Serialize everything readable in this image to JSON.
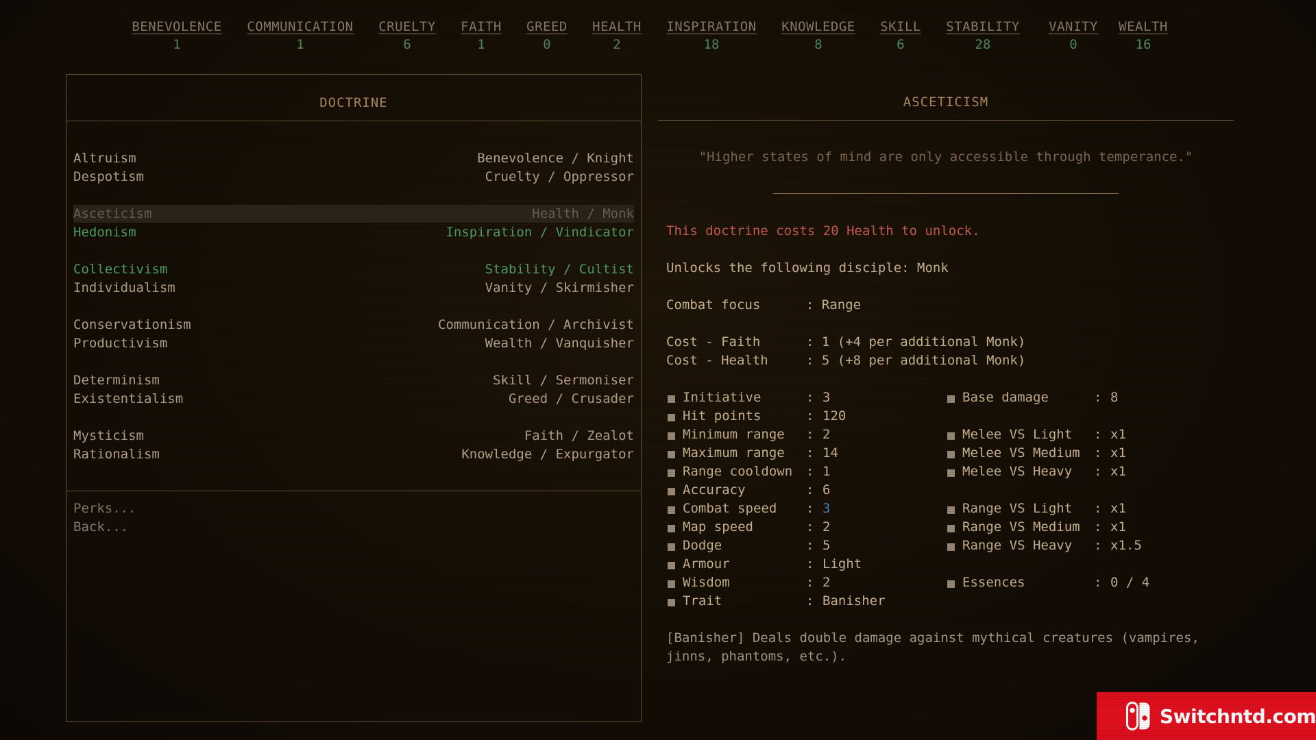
{
  "stats": [
    {
      "name": "BENEVOLENCE",
      "value": "1"
    },
    {
      "name": "COMMUNICATION",
      "value": "1"
    },
    {
      "name": "CRUELTY",
      "value": "6"
    },
    {
      "name": "FAITH",
      "value": "1"
    },
    {
      "name": "GREED",
      "value": "0"
    },
    {
      "name": "HEALTH",
      "value": "2"
    },
    {
      "name": "INSPIRATION",
      "value": "18"
    },
    {
      "name": "KNOWLEDGE",
      "value": "8"
    },
    {
      "name": "SKILL",
      "value": "6"
    },
    {
      "name": "STABILITY",
      "value": "28"
    },
    {
      "name": "VANITY",
      "value": "0"
    },
    {
      "name": "WEALTH",
      "value": "16"
    }
  ],
  "left_panel": {
    "title": "DOCTRINE",
    "doctrines": [
      {
        "name": "Altruism",
        "info": "Benevolence / Knight",
        "state": "normal"
      },
      {
        "name": "Despotism",
        "info": "Cruelty / Oppressor",
        "state": "normal"
      },
      {
        "name": "Asceticism",
        "info": "Health / Monk",
        "state": "selected"
      },
      {
        "name": "Hedonism",
        "info": "Inspiration / Vindicator",
        "state": "unlocked"
      },
      {
        "name": "Collectivism",
        "info": "Stability / Cultist",
        "state": "unlocked"
      },
      {
        "name": "Individualism",
        "info": "Vanity / Skirmisher",
        "state": "normal"
      },
      {
        "name": "Conservationism",
        "info": "Communication / Archivist",
        "state": "normal"
      },
      {
        "name": "Productivism",
        "info": "Wealth / Vanquisher",
        "state": "normal"
      },
      {
        "name": "Determinism",
        "info": "Skill / Sermoniser",
        "state": "normal"
      },
      {
        "name": "Existentialism",
        "info": "Greed / Crusader",
        "state": "normal"
      },
      {
        "name": "Mysticism",
        "info": "Faith / Zealot",
        "state": "normal"
      },
      {
        "name": "Rationalism",
        "info": "Knowledge / Expurgator",
        "state": "normal"
      }
    ],
    "menu": {
      "perks": "Perks...",
      "back": "Back..."
    }
  },
  "right_panel": {
    "title": "ASCETICISM",
    "quote": "\"Higher states of mind are only accessible through temperance.\"",
    "cost_text": "This doctrine costs 20 Health to unlock.",
    "unlocks_text": "Unlocks the following disciple: Monk",
    "combat_focus": {
      "label": "Combat focus",
      "value": ": Range"
    },
    "cost_faith": {
      "label": "Cost - Faith",
      "value": ": 1 (+4 per additional Monk)"
    },
    "cost_health": {
      "label": "Cost - Health",
      "value": ": 5 (+8 per additional Monk)"
    },
    "stats_left": [
      {
        "label": "Initiative",
        "value": "3"
      },
      {
        "label": "Hit points",
        "value": "120"
      },
      {
        "label": "Minimum range",
        "value": "2"
      },
      {
        "label": "Maximum range",
        "value": "14"
      },
      {
        "label": "Range cooldown",
        "value": "1"
      },
      {
        "label": "Accuracy",
        "value": "6"
      },
      {
        "label": "Combat speed",
        "value": "3"
      },
      {
        "label": "Map speed",
        "value": "2"
      },
      {
        "label": "Dodge",
        "value": "5"
      },
      {
        "label": "Armour",
        "value": "Light"
      },
      {
        "label": "Wisdom",
        "value": "2"
      },
      {
        "label": "Trait",
        "value": "Banisher"
      }
    ],
    "stats_right": [
      {
        "label": "Base damage",
        "value": "8"
      },
      {
        "label": "Melee VS Light",
        "value": "x1"
      },
      {
        "label": "Melee VS Medium",
        "value": "x1"
      },
      {
        "label": "Melee VS Heavy",
        "value": "x1"
      },
      {
        "label": "Range VS Light",
        "value": "x1"
      },
      {
        "label": "Range VS Medium",
        "value": "x1"
      },
      {
        "label": "Range VS Heavy",
        "value": "x1.5"
      },
      {
        "label": "Essences",
        "value": "0 / 4"
      }
    ],
    "trait_description": "[Banisher] Deals double damage against mythical creatures (vampires, jinns, phantoms, etc.)."
  },
  "watermark": {
    "text": "Switchntd.com"
  },
  "colors": {
    "background": "#150e05",
    "accent_green": "#4fa065",
    "cost_red": "#c55a4e",
    "highlight_blue": "#4b86b8",
    "border": "#6b5638",
    "watermark_red": "#e2101e"
  }
}
